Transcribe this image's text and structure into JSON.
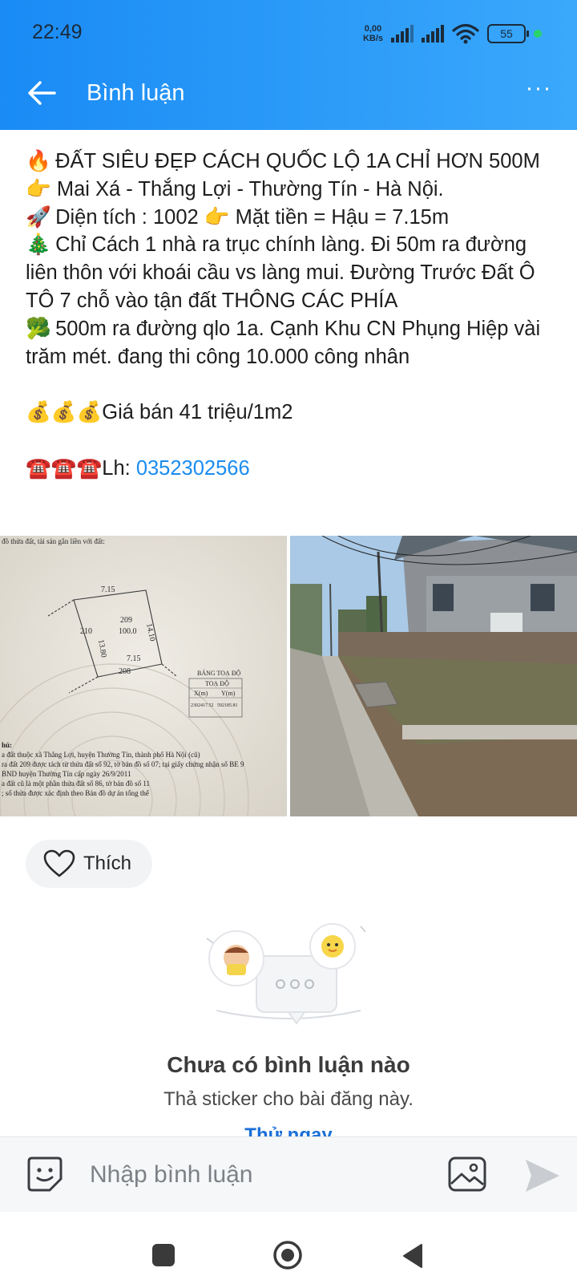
{
  "status_bar": {
    "time": "22:49",
    "net_speed_value": "0,00",
    "net_speed_unit": "KB/s",
    "battery": "55"
  },
  "header": {
    "title": "Bình luận",
    "back_icon": "arrow-left-icon",
    "more_icon": "more-dots-icon",
    "more_label": "···"
  },
  "post": {
    "lines": [
      {
        "emoji": "🔥",
        "text": " ĐẤT SIÊU ĐẸP CÁCH QUỐC LỘ 1A CHỈ HƠN 500M 👉 Mai Xá - Thắng Lợi - Thường Tín - Hà Nội."
      },
      {
        "emoji": "🚀",
        "text": " Diện tích : 1002 👉 Mặt tiền = Hậu = 7.15m"
      },
      {
        "emoji": "🎄",
        "text": " Chỉ Cách 1 nhà ra trục chính làng. Đi 50m ra đường liên thôn với khoái cầu vs làng mui. Đường Trước Đất Ô TÔ 7 chỗ vào tận đất THÔNG CÁC PHÍA"
      },
      {
        "emoji": "🥦",
        "text": " 500m ra đường qlo 1a. Cạnh Khu CN Phụng Hiệp vài trăm mét. đang thi công 10.000 công nhân"
      }
    ],
    "price_emoji": "💰💰💰",
    "price_text": "Giá bán 41 triệu/1m2",
    "contact_emoji": "☎️☎️☎️",
    "contact_label": "Lh: ",
    "phone": "0352302566"
  },
  "photos": {
    "map_header": "đồ thửa đất, tài sản gắn liền với đất:",
    "map_edge_top": "7.15",
    "map_edge_right": "14.10",
    "map_edge_left": "13.80",
    "map_edge_bottom": "7.15",
    "parcel_number": "209",
    "parcel_area": "100.0",
    "neighbor_left": "210",
    "neighbor_bottom": "208",
    "coord_table_title": "BẢNG TOẠ ĐỘ",
    "coord_table_sub": "TOẠ ĐỘ",
    "coord_col_x": "X(m)",
    "coord_col_y": "Y(m)",
    "coord_x": "2302417.52",
    "coord_y": "592185.81",
    "notes_title": "hú:",
    "notes": [
      "a đất thuộc xã Thắng Lợi, huyện Thường Tín, thành phố Hà Nội (cũ)",
      "ra đất 209 được tách từ thửa đất số 92, tờ bản đồ số 07; tại giấy chứng nhận số BE 9",
      "BND huyện Thường Tín cấp ngày 26/9/2011",
      "a đất cũ là một phần thửa đất số 86, tờ bản đồ số 11",
      "; số thửa được xác định theo Bản đồ dự án tổng thể"
    ]
  },
  "actions": {
    "like_label": "Thích",
    "like_icon": "heart-outline-icon"
  },
  "empty_state": {
    "title": "Chưa có bình luận nào",
    "subtitle": "Thả sticker cho bài đăng này.",
    "try_label": "Thử ngay"
  },
  "composer": {
    "placeholder": "Nhập bình luận",
    "sticker_icon": "sticker-smile-icon",
    "image_icon": "image-icon",
    "send_icon": "send-icon"
  },
  "colors": {
    "header_start": "#1a8bf5",
    "header_end": "#3aa8fb",
    "link": "#1a8cf0"
  }
}
